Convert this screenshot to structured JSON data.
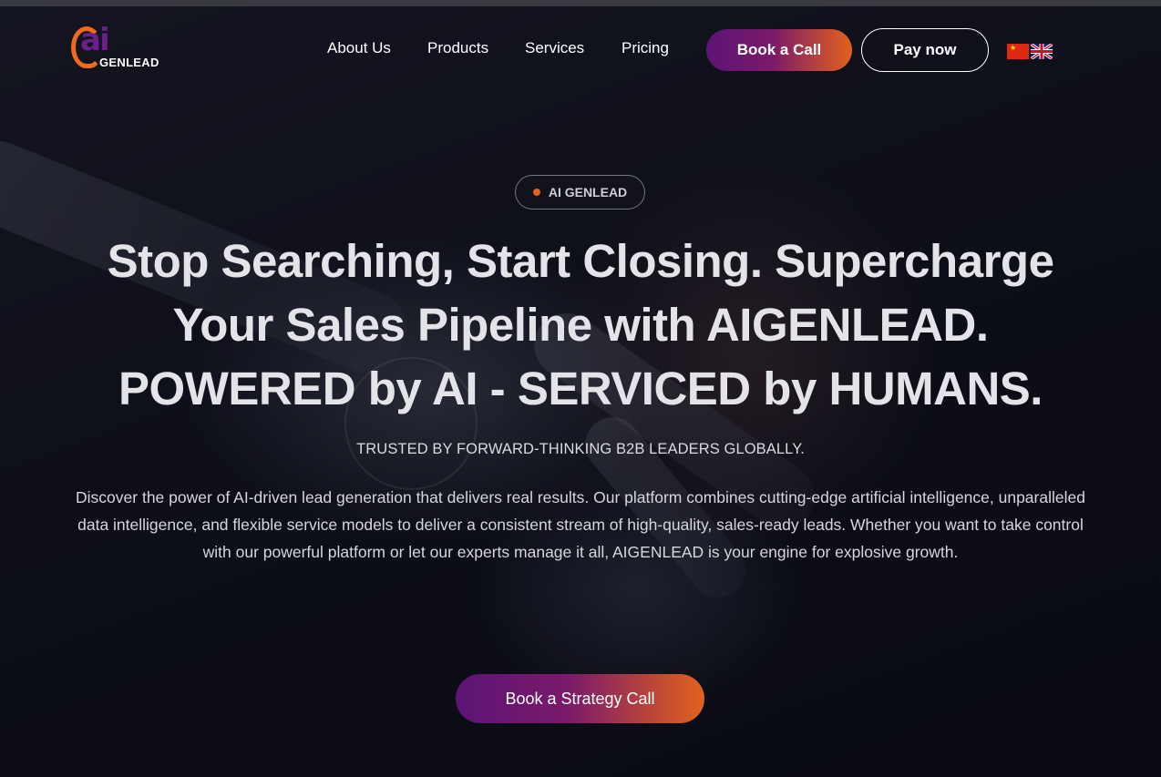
{
  "brand": {
    "logo_mark": "ai",
    "logo_name": "GENLEAD"
  },
  "nav": {
    "links": [
      {
        "label": "About Us"
      },
      {
        "label": "Products"
      },
      {
        "label": "Services"
      },
      {
        "label": "Pricing"
      }
    ],
    "book_call_label": "Book a Call",
    "pay_now_label": "Pay now",
    "languages": [
      {
        "icon": "flag-china-icon"
      },
      {
        "icon": "flag-uk-icon"
      }
    ]
  },
  "hero": {
    "badge": "AI GENLEAD",
    "headline_lines": [
      "Stop Searching, Start Closing. Supercharge",
      "Your Sales Pipeline with AIGENLEAD.",
      "POWERED by AI - SERVICED by HUMANS."
    ],
    "trusted": "TRUSTED BY FORWARD-THINKING B2B LEADERS GLOBALLY.",
    "description": "Discover the power of AI-driven lead generation that delivers real results. Our platform combines cutting-edge artificial intelligence, unparalleled data intelligence, and flexible service models to deliver a consistent stream of high-quality, sales-ready leads. Whether you want to take control with our powerful platform or let our experts manage it all, AIGENLEAD is your engine for explosive growth.",
    "cta_label": "Book a Strategy Call"
  },
  "colors": {
    "accent_purple": "#5c1475",
    "accent_orange": "#e2621b",
    "background": "#0d0f1a"
  }
}
